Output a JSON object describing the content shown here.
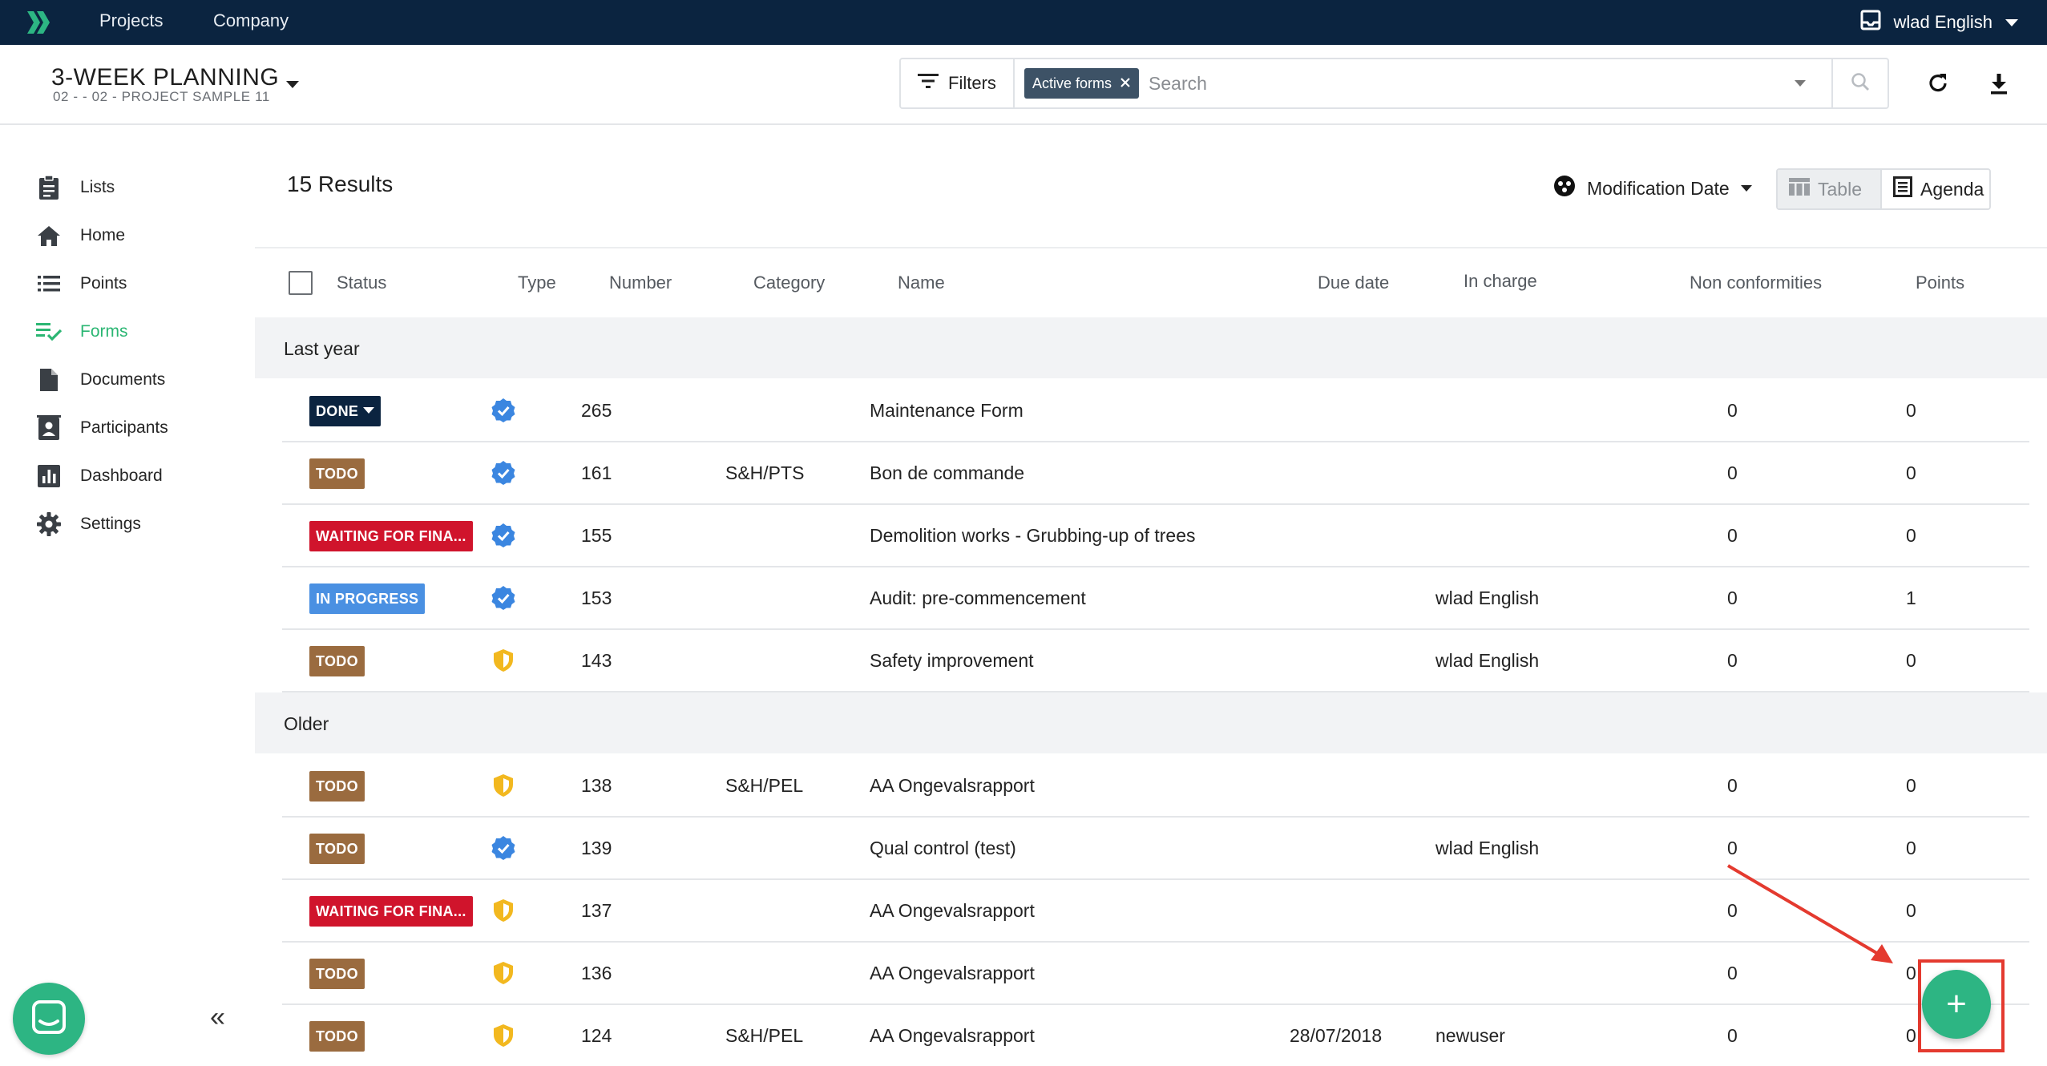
{
  "topbar": {
    "nav": [
      "Projects",
      "Company"
    ],
    "user_name": "wlad English"
  },
  "subheader": {
    "title": "3-WEEK PLANNING",
    "subtitle": "02 - - 02 - PROJECT SAMPLE 11",
    "filters_label": "Filters",
    "chip_label": "Active forms",
    "search_placeholder": "Search"
  },
  "sidebar": {
    "items": [
      {
        "label": "Lists",
        "icon": "clipboard-icon"
      },
      {
        "label": "Home",
        "icon": "home-icon"
      },
      {
        "label": "Points",
        "icon": "list-icon"
      },
      {
        "label": "Forms",
        "icon": "forms-check-icon"
      },
      {
        "label": "Documents",
        "icon": "document-icon"
      },
      {
        "label": "Participants",
        "icon": "participants-icon"
      },
      {
        "label": "Dashboard",
        "icon": "bar-chart-icon"
      },
      {
        "label": "Settings",
        "icon": "gear-icon"
      }
    ],
    "active": "Forms",
    "collapse_label": "«"
  },
  "main": {
    "results_label": "15  Results",
    "sort_label": "Modification Date",
    "view_table": "Table",
    "view_agenda": "Agenda",
    "columns": [
      "Status",
      "Type",
      "Number",
      "Category",
      "Name",
      "Due date",
      "In charge",
      "Non conformities",
      "Points"
    ],
    "groups": [
      {
        "label": "Last year",
        "rows": [
          {
            "status": "DONE",
            "status_color": "#0b2440",
            "type": "verified-icon",
            "number": "265",
            "category": "",
            "name": "Maintenance Form",
            "due": "",
            "in_charge": "",
            "nc": "0",
            "points": "0"
          },
          {
            "status": "TODO",
            "status_color": "#9a6b3f",
            "type": "verified-icon",
            "number": "161",
            "category": "S&H/PTS",
            "name": "Bon de commande",
            "due": "",
            "in_charge": "",
            "nc": "0",
            "points": "0"
          },
          {
            "status": "WAITING FOR FINA...",
            "status_color": "#d0142c",
            "type": "verified-icon",
            "number": "155",
            "category": "",
            "name": "Demolition works - Grubbing-up of trees",
            "due": "",
            "in_charge": "",
            "nc": "0",
            "points": "0"
          },
          {
            "status": "IN PROGRESS",
            "status_color": "#4a90e2",
            "type": "verified-icon",
            "number": "153",
            "category": "",
            "name": "Audit: pre-commencement",
            "due": "",
            "in_charge": "wlad English",
            "nc": "0",
            "points": "1"
          },
          {
            "status": "TODO",
            "status_color": "#9a6b3f",
            "type": "shield-icon",
            "number": "143",
            "category": "",
            "name": "Safety improvement",
            "due": "",
            "in_charge": "wlad English",
            "nc": "0",
            "points": "0"
          }
        ]
      },
      {
        "label": "Older",
        "rows": [
          {
            "status": "TODO",
            "status_color": "#9a6b3f",
            "type": "shield-icon",
            "number": "138",
            "category": "S&H/PEL",
            "name": "AA Ongevalsrapport",
            "due": "",
            "in_charge": "",
            "nc": "0",
            "points": "0"
          },
          {
            "status": "TODO",
            "status_color": "#9a6b3f",
            "type": "verified-icon",
            "number": "139",
            "category": "",
            "name": "Qual control (test)",
            "due": "",
            "in_charge": "wlad English",
            "nc": "0",
            "points": "0"
          },
          {
            "status": "WAITING FOR FINA...",
            "status_color": "#d0142c",
            "type": "shield-icon",
            "number": "137",
            "category": "",
            "name": "AA Ongevalsrapport",
            "due": "",
            "in_charge": "",
            "nc": "0",
            "points": "0"
          },
          {
            "status": "TODO",
            "status_color": "#9a6b3f",
            "type": "shield-icon",
            "number": "136",
            "category": "",
            "name": "AA Ongevalsrapport",
            "due": "",
            "in_charge": "",
            "nc": "0",
            "points": "0"
          },
          {
            "status": "TODO",
            "status_color": "#9a6b3f",
            "type": "shield-icon",
            "number": "124",
            "category": "S&H/PEL",
            "name": "AA Ongevalsrapport",
            "due": "28/07/2018",
            "in_charge": "newuser",
            "nc": "0",
            "points": "0"
          }
        ]
      }
    ],
    "fab_label": "+"
  },
  "colors": {
    "topbar": "#0b2440",
    "accent_green": "#2db583",
    "annotation_red": "#e43a2f"
  }
}
